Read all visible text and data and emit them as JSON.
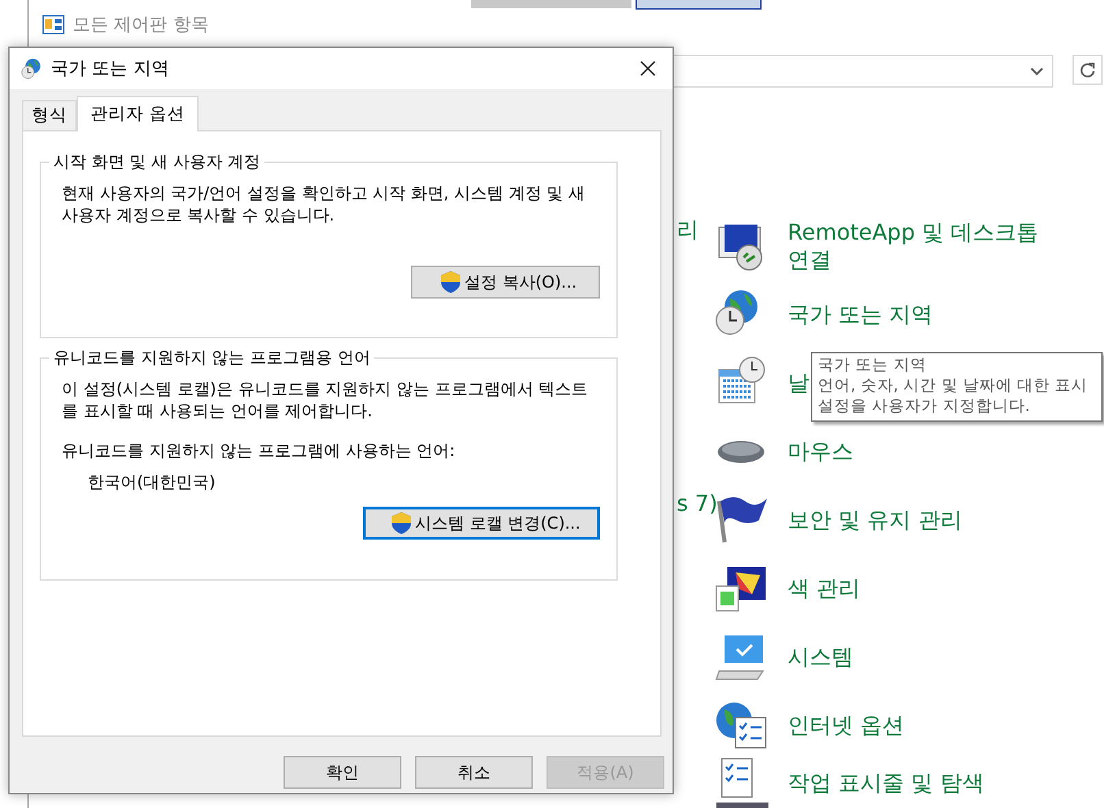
{
  "background_window": {
    "title": "모든 제어판 항목",
    "left_column": [
      {
        "label": "리"
      },
      {
        "label": "s 7)"
      }
    ],
    "items": [
      {
        "label": "RemoteApp 및 데스크톱\n연결"
      },
      {
        "label": "국가 또는 지역"
      },
      {
        "label": "날"
      },
      {
        "label": "마우스"
      },
      {
        "label": "보안 및 유지 관리"
      },
      {
        "label": "색 관리"
      },
      {
        "label": "시스템"
      },
      {
        "label": "인터넷 옵션"
      },
      {
        "label": "작업 표시줄 및 탐색"
      }
    ]
  },
  "tooltip": {
    "title": "국가 또는 지역",
    "text": "언어, 숫자, 시간 및 날짜에 대한 표시\n설정을 사용자가 지정합니다."
  },
  "dialog": {
    "title": "국가 또는 지역",
    "tabs": [
      {
        "label": "형식",
        "selected": false
      },
      {
        "label": "관리자 옵션",
        "selected": true
      }
    ],
    "groups": [
      {
        "title": "시작 화면 및 새 사용자 계정",
        "description": "현재 사용자의 국가/언어 설정을 확인하고 시작 화면, 시스템 계정 및 새\n사용자 계정으로 복사할 수 있습니다.",
        "button": {
          "label": "설정 복사(O)...",
          "focused": false
        }
      },
      {
        "title": "유니코드를 지원하지 않는 프로그램용 언어",
        "description": "이 설정(시스템 로캘)은 유니코드를 지원하지 않는 프로그램에서 텍스트\n를 표시할 때 사용되는 언어를 제어합니다.",
        "field_label": "유니코드를 지원하지 않는 프로그램에 사용하는 언어:",
        "field_value": "한국어(대한민국)",
        "button": {
          "label": "시스템 로캘 변경(C)...",
          "focused": true
        }
      }
    ],
    "buttons": [
      {
        "label": "확인",
        "disabled": false
      },
      {
        "label": "취소",
        "disabled": false
      },
      {
        "label": "적용(A)",
        "disabled": true
      }
    ]
  }
}
